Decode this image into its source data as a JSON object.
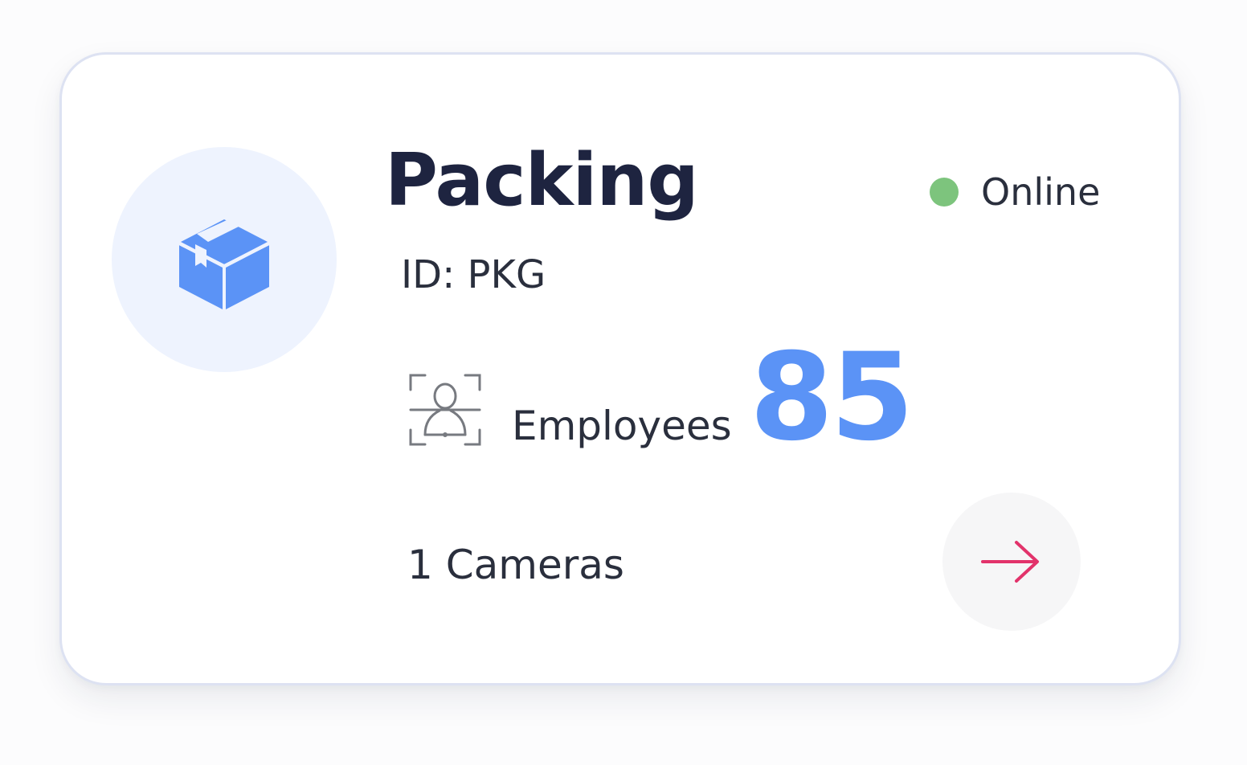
{
  "card": {
    "title": "Packing",
    "status": {
      "label": "Online",
      "color": "#7dc47d"
    },
    "id_text": "ID: PKG",
    "employees": {
      "label": "Employees",
      "count": "85",
      "count_color": "#5b93f6"
    },
    "cameras_text": "1 Cameras",
    "icons": {
      "main": "package-box-icon",
      "employees": "face-scan-icon",
      "action": "arrow-right-icon"
    },
    "colors": {
      "accent": "#5b93f6",
      "icon_bg": "#eef3fe",
      "arrow": "#e2336b",
      "title": "#1e2440"
    }
  }
}
